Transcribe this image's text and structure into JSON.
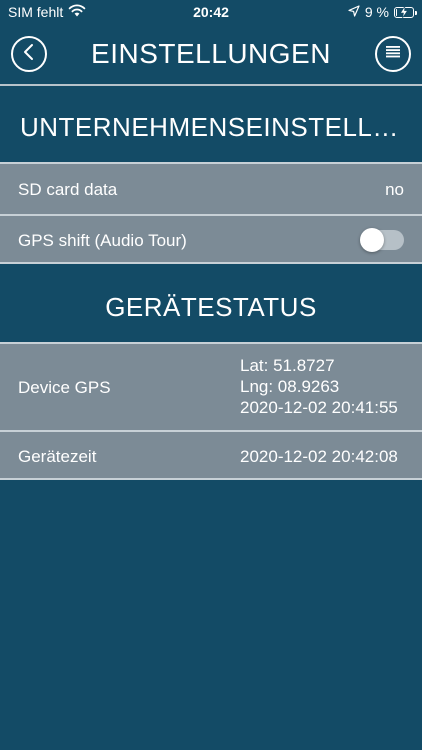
{
  "status_bar": {
    "carrier": "SIM fehlt",
    "time": "20:42",
    "battery_text": "9 %",
    "battery_level": 0.09,
    "icons": [
      "wifi-icon",
      "location-arrow-icon",
      "battery-charging-icon"
    ]
  },
  "nav": {
    "title": "EINSTELLUNGEN",
    "back_icon": "chevron-left-icon",
    "menu_icon": "menu-icon"
  },
  "sections": [
    {
      "title": "UNTERNEHMENSEINSTELLU…",
      "rows": [
        {
          "label": "SD card data",
          "value": "no"
        },
        {
          "label": "GPS shift (Audio Tour)",
          "toggle": false
        }
      ]
    },
    {
      "title": "GERÄTESTATUS",
      "rows": [
        {
          "label": "Device GPS",
          "lines": [
            "Lat: 51.8727",
            "Lng: 08.9263",
            "2020-12-02 20:41:55"
          ]
        },
        {
          "label": "Gerätezeit",
          "value": "2020-12-02 20:42:08"
        }
      ]
    }
  ],
  "colors": {
    "background": "#134b66",
    "row_background": "#7c8b96",
    "divider": "#c7d0d6",
    "text": "#ffffff"
  }
}
